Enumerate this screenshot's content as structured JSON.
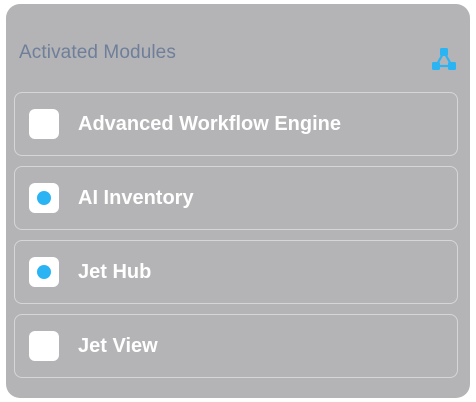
{
  "panel": {
    "title": "Activated Modules",
    "icon": "network-icon",
    "accent_color": "#2ab4f4",
    "background_color": "#b4b4b6",
    "title_color": "#6f7f9a"
  },
  "modules": [
    {
      "label": "Advanced Workflow Engine",
      "checked": false
    },
    {
      "label": "AI Inventory",
      "checked": true
    },
    {
      "label": "Jet Hub",
      "checked": true
    },
    {
      "label": "Jet View",
      "checked": false
    }
  ]
}
